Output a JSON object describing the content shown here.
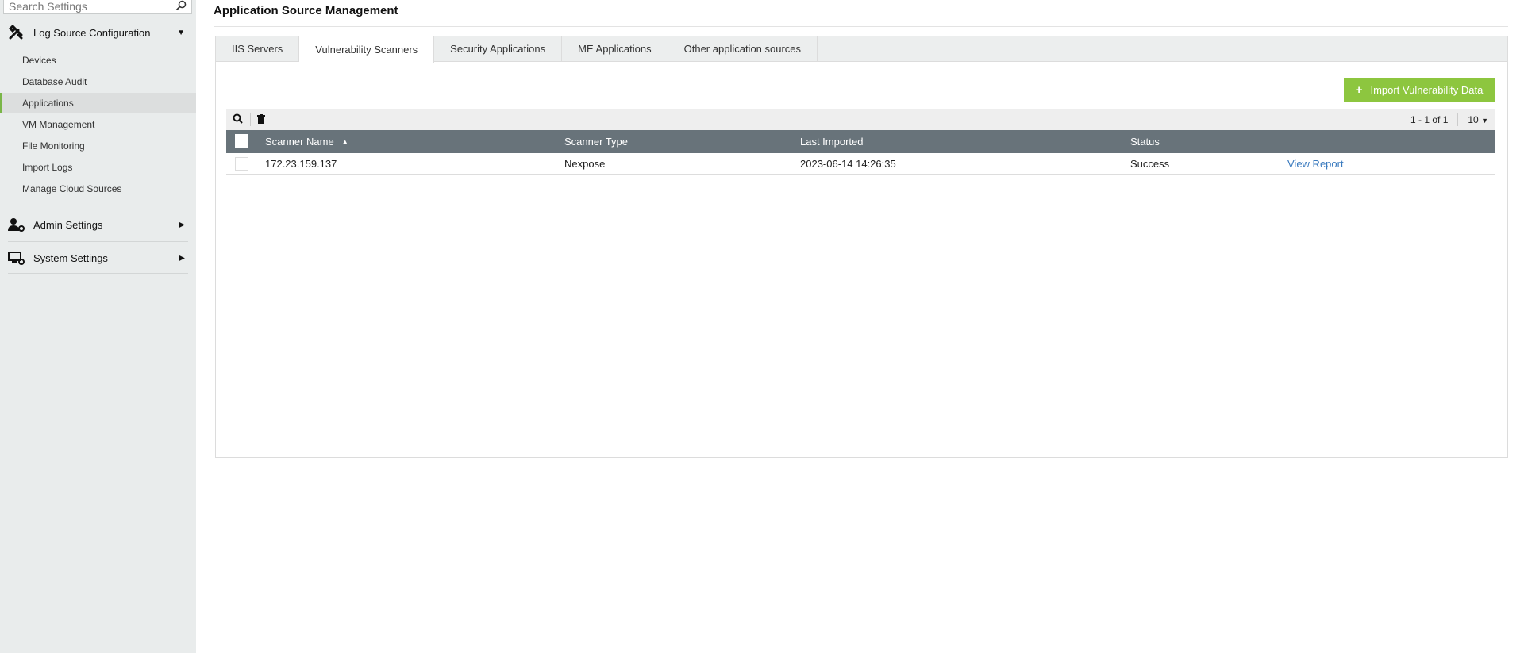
{
  "sidebar": {
    "search_placeholder": "Search Settings",
    "groups": [
      {
        "label": "Log Source Configuration",
        "icon": "tools-icon",
        "expanded": true
      },
      {
        "label": "Admin Settings",
        "icon": "user-gear-icon"
      },
      {
        "label": "System Settings",
        "icon": "monitor-gear-icon"
      }
    ],
    "items": [
      "Devices",
      "Database Audit",
      "Applications",
      "VM Management",
      "File Monitoring",
      "Import Logs",
      "Manage Cloud Sources"
    ],
    "active_item": "Applications"
  },
  "page": {
    "title": "Application Source Management"
  },
  "tabs": [
    "IIS Servers",
    "Vulnerability Scanners",
    "Security Applications",
    "ME Applications",
    "Other application sources"
  ],
  "active_tab": "Vulnerability Scanners",
  "import_button": "Import Vulnerability Data",
  "pagination": {
    "range": "1 - 1 of 1",
    "page_size": "10"
  },
  "table": {
    "columns": [
      "Scanner Name",
      "Scanner Type",
      "Last Imported",
      "Status"
    ],
    "rows": [
      {
        "name": "172.23.159.137",
        "type": "Nexpose",
        "last_imported": "2023-06-14 14:26:35",
        "status": "Success",
        "action": "View Report"
      }
    ]
  },
  "colors": {
    "accent": "#8dc63f",
    "header": "#68737a",
    "link": "#3b7bbf"
  }
}
